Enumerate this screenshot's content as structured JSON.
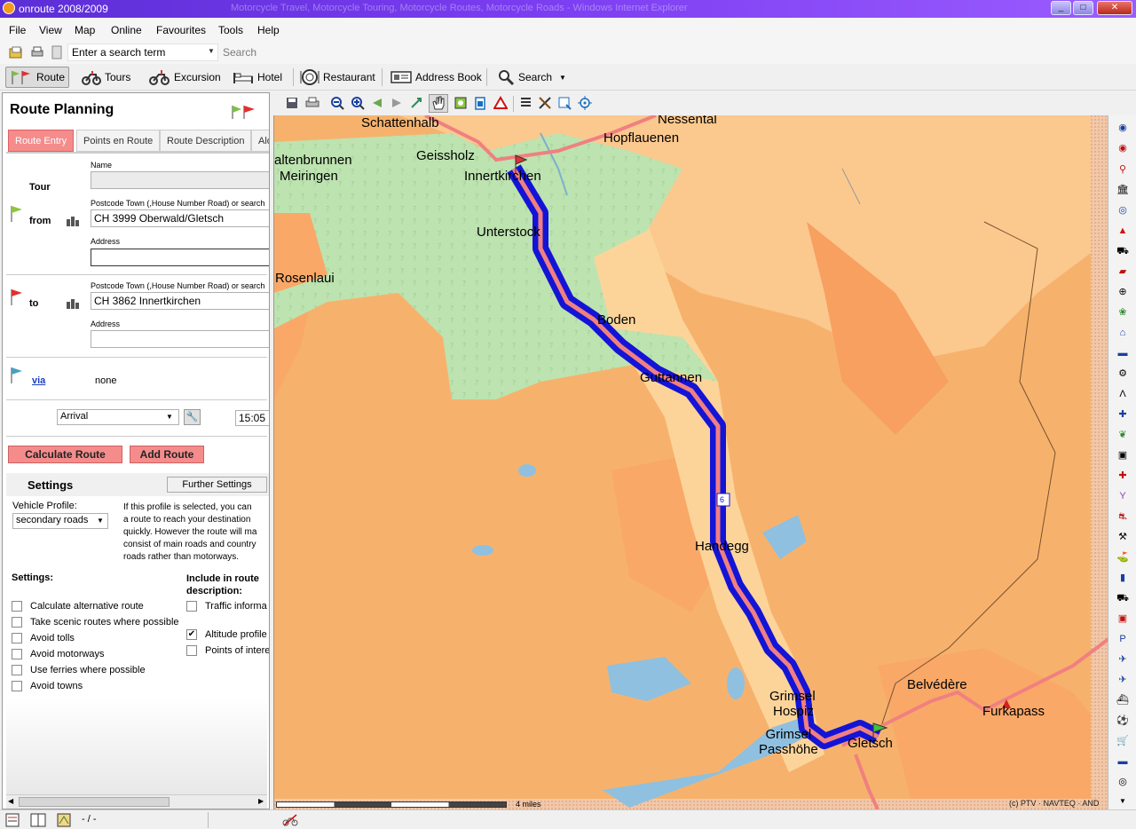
{
  "window": {
    "title": "onroute 2008/2009",
    "ghost_text": "Motorcycle Travel, Motorcycle Touring, Motorcycle Routes, Motorcycle Roads - Windows Internet Explorer",
    "buttons": {
      "minimize": "_",
      "maximize": "□",
      "close": "✕"
    }
  },
  "menu": [
    "File",
    "View",
    "Map",
    "Online",
    "Favourites",
    "Tools",
    "Help"
  ],
  "search": {
    "placeholder": "Enter a search term",
    "button": "Search"
  },
  "toolbar": {
    "route": "Route",
    "tours": "Tours",
    "excursion": "Excursion",
    "hotel": "Hotel",
    "restaurant": "Restaurant",
    "address_book": "Address Book",
    "search": "Search"
  },
  "route_planning": {
    "title": "Route Planning",
    "tabs": [
      "Route Entry",
      "Points en Route",
      "Route Description",
      "Alo"
    ],
    "tour_label": "Tour",
    "name_label": "Name",
    "name_value": "",
    "from_label": "from",
    "from_postcode_label": "Postcode Town (,House Number Road) or search",
    "from_value": "CH 3999 Oberwald/Gletsch",
    "address_label": "Address",
    "from_address": "",
    "to_label": "to",
    "to_postcode_label": "Postcode Town (,House Number Road) or search",
    "to_value": "CH 3862 Innertkirchen",
    "to_address_label": "Address",
    "to_address": "",
    "via_label": "via",
    "via_value": "none",
    "time_mode": "Arrival",
    "time_value": "15:05",
    "calculate_btn": "Calculate Route",
    "add_btn": "Add Route"
  },
  "settings": {
    "title": "Settings",
    "further_btn": "Further Settings",
    "vehicle_profile_label": "Vehicle Profile:",
    "vehicle_profile_value": "secondary roads",
    "profile_desc": [
      "If this profile is selected, you can",
      "a route to reach your destination",
      "quickly. However the route will ma",
      "consist of main roads and country",
      "roads rather than motorways."
    ],
    "settings_label": "Settings:",
    "include_label_1": "Include in route",
    "include_label_2": "description:",
    "options": [
      {
        "label": "Calculate alternative route",
        "checked": false
      },
      {
        "label": "Take scenic routes where possible",
        "checked": false
      },
      {
        "label": "Avoid tolls",
        "checked": false
      },
      {
        "label": "Avoid motorways",
        "checked": false
      },
      {
        "label": "Use ferries where possible",
        "checked": false
      },
      {
        "label": "Avoid towns",
        "checked": false
      }
    ],
    "include": [
      {
        "label": "Traffic informa",
        "checked": false
      },
      {
        "label": "Altitude profile",
        "checked": true
      },
      {
        "label": "Points of intere",
        "checked": false
      }
    ]
  },
  "map": {
    "places": {
      "schattenhalb": "Schattenhalb",
      "nessental": "Nessental",
      "hopflauenen": "Hopflauenen",
      "geissholz": "Geissholz",
      "innertkirchen": "Innertkirchen",
      "altenbrunnen": "altenbrunnen",
      "meiringen": "Meiringen",
      "unterstock": "Unterstock",
      "rosenlaui": "Rosenlaui",
      "boden": "Boden",
      "guttannen": "Guttannen",
      "handegg": "Handegg",
      "grimsel_hospiz_1": "Grimsel",
      "grimsel_hospiz_2": "Hospiz",
      "grimsel_pass_1": "Grimsel",
      "grimsel_pass_2": "Passhöhe",
      "gletsch": "Gletsch",
      "belvedere": "Belvédère",
      "furkapass": "Furkapass"
    },
    "road_shield": "6",
    "scale_label": "4 miles",
    "copyright": "(c) PTV · NAVTEQ · AND",
    "colors": {
      "terrain": "#f5b067",
      "lowland": "#fcd49a",
      "forest": "#b8e0a8",
      "water": "#8fc0e0",
      "route_outer": "#1010d8",
      "route_inner": "#f08080"
    }
  },
  "status": {
    "text": "- / -"
  }
}
